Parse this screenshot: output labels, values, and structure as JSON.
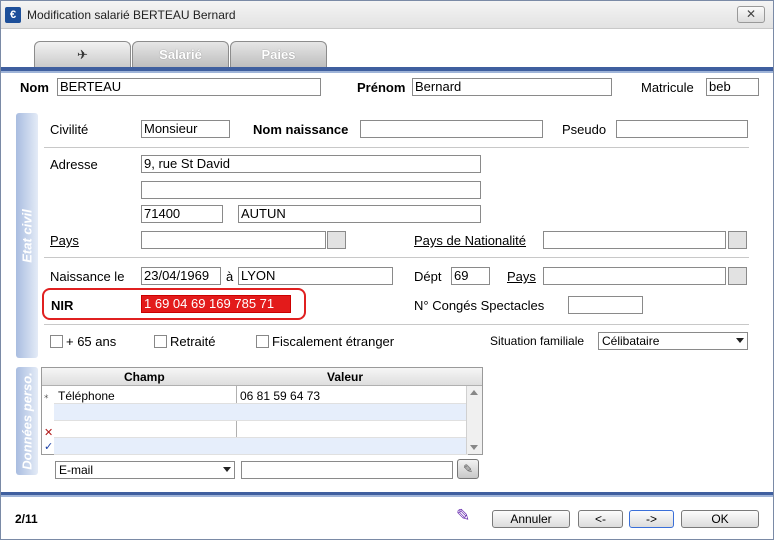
{
  "window": {
    "title": "Modification salarié BERTEAU Bernard",
    "close": "✕",
    "app_icon": "€"
  },
  "tabs": [
    {
      "label": "✈"
    },
    {
      "label": "Salarié"
    },
    {
      "label": "Paies"
    }
  ],
  "header": {
    "nom_label": "Nom",
    "nom_value": "BERTEAU",
    "prenom_label": "Prénom",
    "prenom_value": "Bernard",
    "matricule_label": "Matricule",
    "matricule_value": "beb"
  },
  "etat_civil": {
    "section_title": "Etat civil",
    "civilite_label": "Civilité",
    "civilite_value": "Monsieur",
    "nom_naissance_label": "Nom naissance",
    "nom_naissance_value": "",
    "pseudo_label": "Pseudo",
    "pseudo_value": "",
    "adresse_label": "Adresse",
    "adresse_line1": "9, rue St David",
    "adresse_line2": "",
    "code_postal": "71400",
    "ville": "AUTUN",
    "pays_label": "Pays",
    "pays_value": "",
    "pays_nat_label": "Pays de Nationalité",
    "pays_nat_value": "",
    "naissance_label": "Naissance le",
    "naissance_date": "23/04/1969",
    "a_label": "à",
    "naissance_lieu": "LYON",
    "dept_label": "Dépt",
    "dept_value": "69",
    "pays2_label": "Pays",
    "pays2_value": "",
    "nir_label": "NIR",
    "nir_value": "1 69 04 69 169 785 71",
    "conges_label": "N° Congés Spectacles",
    "conges_value": "",
    "plus65_label": "+ 65 ans",
    "retraite_label": "Retraité",
    "fiscal_label": "Fiscalement étranger",
    "situation_label": "Situation familiale",
    "situation_value": "Célibataire"
  },
  "donnees": {
    "section_title": "Données perso.",
    "col_champ": "Champ",
    "col_valeur": "Valeur",
    "rows": [
      {
        "champ": "Téléphone",
        "valeur": "06 81 59 64 73"
      }
    ],
    "new_type": "E-mail",
    "new_value": ""
  },
  "footer": {
    "record_count": "2/11",
    "annuler": "Annuler",
    "prev": "<-",
    "next": "->",
    "ok": "OK"
  },
  "colors": {
    "accent": "#3f5f9f",
    "nir_bg": "#e31b1b",
    "highlight": "#e02020"
  }
}
